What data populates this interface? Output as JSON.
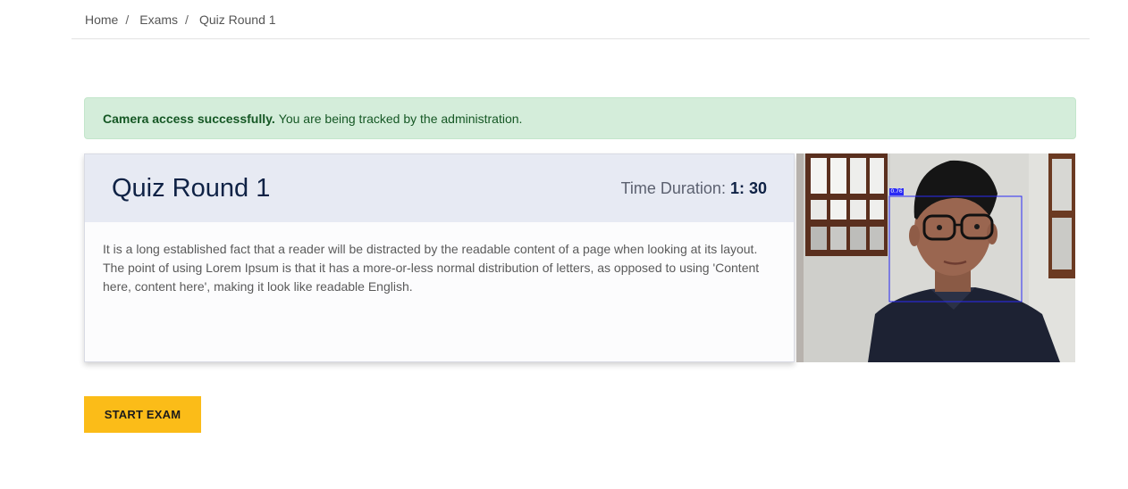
{
  "breadcrumb": {
    "items": [
      "Home",
      "Exams",
      "Quiz Round 1"
    ],
    "separator": "/"
  },
  "alert": {
    "bold": "Camera access successfully.",
    "text": "You are being tracked by the administration."
  },
  "quiz": {
    "title": "Quiz Round 1",
    "duration_label": "Time Duration:",
    "duration_value": "1: 30",
    "description": "It is a long established fact that a reader will be distracted by the readable content of a page when looking at its layout. The point of using Lorem Ipsum is that it has a more-or-less normal distribution of letters, as opposed to using 'Content here, content here', making it look like readable English."
  },
  "camera": {
    "face_confidence": "0.76",
    "box_color": "#2a2af5"
  },
  "actions": {
    "start_label": "START EXAM"
  },
  "colors": {
    "alert_bg": "#d4edda",
    "card_header_bg": "#e7eaf3",
    "button_bg": "#fbbc18"
  }
}
